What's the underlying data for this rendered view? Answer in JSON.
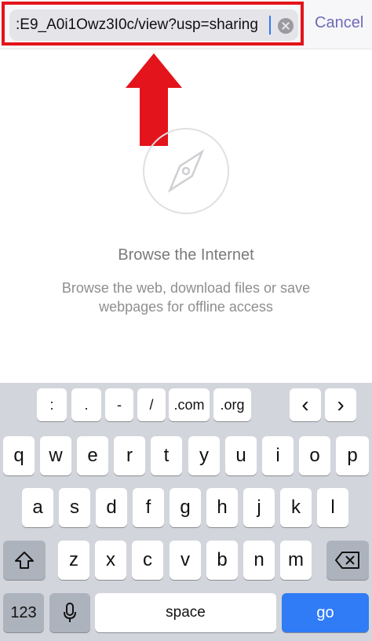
{
  "address_bar": {
    "url_text": ":E9_A0i1Owz3I0c/view?usp=sharing",
    "cancel_label": "Cancel",
    "clear_icon": "clear-circle-x-icon"
  },
  "annotation": {
    "arrow_icon": "red-up-arrow",
    "highlight_color": "#e3141b"
  },
  "empty_state": {
    "icon": "compass-icon",
    "title": "Browse the Internet",
    "subtitle_line1": "Browse the web, download files or save",
    "subtitle_line2": "webpages for offline access"
  },
  "keyboard": {
    "top_row": [
      ":",
      ".",
      "-",
      "/",
      ".com",
      ".org"
    ],
    "nav_prev": "‹",
    "nav_next": "›",
    "row1": [
      "q",
      "w",
      "e",
      "r",
      "t",
      "y",
      "u",
      "i",
      "o",
      "p"
    ],
    "row2": [
      "a",
      "s",
      "d",
      "f",
      "g",
      "h",
      "j",
      "k",
      "l"
    ],
    "row3": [
      "z",
      "x",
      "c",
      "v",
      "b",
      "n",
      "m"
    ],
    "shift_icon": "shift-arrow-icon",
    "backspace_icon": "backspace-icon",
    "numbers_label": "123",
    "mic_icon": "microphone-icon",
    "space_label": "space",
    "go_label": "go",
    "go_color": "#2f7cf6"
  }
}
